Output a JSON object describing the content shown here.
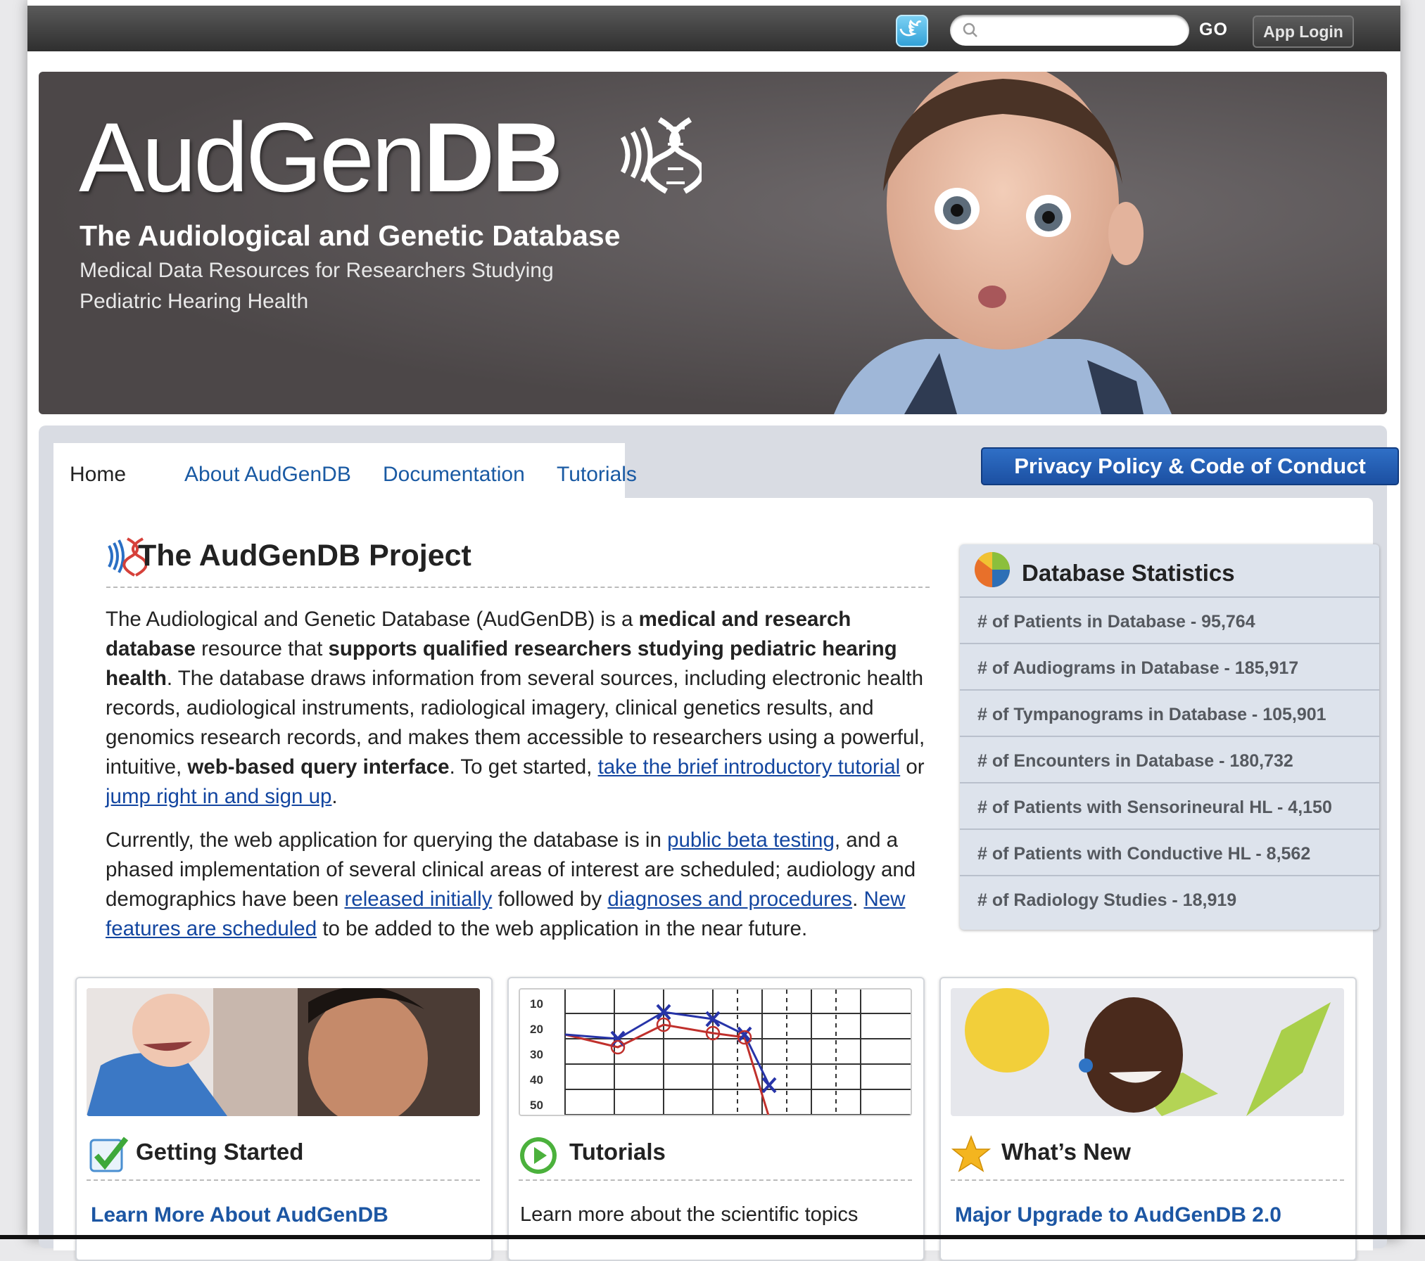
{
  "topbar": {
    "search_placeholder": "",
    "go_label": "GO",
    "app_login_label": "App Login"
  },
  "hero": {
    "logo_part1": "AudGen",
    "logo_part2": "DB",
    "title": "The Audiological and Genetic Database",
    "subtitle_line1": "Medical Data Resources for Researchers Studying",
    "subtitle_line2": "Pediatric Hearing Health"
  },
  "nav": {
    "tabs": [
      {
        "label": "Home"
      },
      {
        "label": "About AudGenDB"
      },
      {
        "label": "Documentation"
      },
      {
        "label": "Tutorials"
      }
    ],
    "privacy_label": "Privacy Policy & Code of Conduct"
  },
  "project": {
    "title": "The AudGenDB Project",
    "p1": {
      "t1": "The Audiological and Genetic Database (AudGenDB) is a ",
      "b1": "medical and research database",
      "t2": " resource that ",
      "b2": "supports qualified researchers studying pediatric hearing health",
      "t3": ". The database draws information from several sources, including electronic health records, audiological instruments, radiological imagery, clinical genetics results, and genomics research records, and makes them accessible to researchers using a powerful, intuitive, ",
      "b3": "web-based query interface",
      "t4": ". To get started, ",
      "link1": "take the brief introductory tutorial",
      "t5": " or ",
      "link2": "jump right in and sign up",
      "t6": "."
    },
    "p2": {
      "t1": "Currently, the web application for querying the database is in ",
      "link1": "public beta testing",
      "t2": ", and a phased implementation of several clinical areas of interest are scheduled; audiology and demographics have been ",
      "link2": "released initially",
      "t3": " followed by ",
      "link3": "diagnoses and procedures",
      "t4": ". ",
      "link4": "New features are scheduled",
      "t5": " to be added to the web application in the near future."
    }
  },
  "stats": {
    "title": "Database Statistics",
    "rows": [
      "# of Patients in Database - 95,764",
      "# of Audiograms in Database - 185,917",
      "# of Tympanograms in Database - 105,901",
      "# of Encounters in Database - 180,732",
      "# of Patients with Sensorineural HL - 4,150",
      "# of Patients with Conductive HL - 8,562",
      "# of Radiology Studies - 18,919"
    ]
  },
  "cards": {
    "getting_started": {
      "title": "Getting Started",
      "link": "Learn More About AudGenDB"
    },
    "tutorials": {
      "title": "Tutorials",
      "text": "Learn more about the scientific topics",
      "y_ticks": [
        "10",
        "20",
        "30",
        "40",
        "50"
      ]
    },
    "whats_new": {
      "title": "What’s New",
      "link": "Major Upgrade to AudGenDB 2.0"
    }
  },
  "colors": {
    "link": "#1346a0",
    "privacy_button": "#1c50a2",
    "topbar": "#3a3a3a"
  }
}
